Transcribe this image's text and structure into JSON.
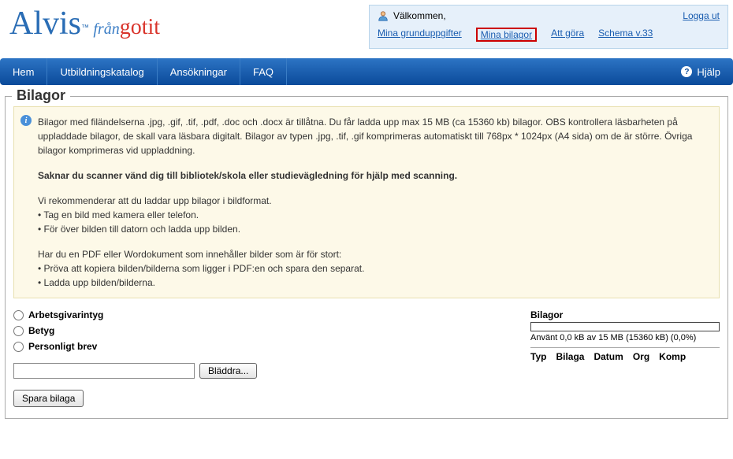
{
  "logo": {
    "main": "Alvis",
    "tm": "™",
    "fran": "från",
    "gotit": "gotit"
  },
  "welcome": {
    "greeting": "Välkommen,",
    "logout": "Logga ut",
    "links": [
      {
        "label": "Mina grunduppgifter",
        "active": false
      },
      {
        "label": "Mina bilagor",
        "active": true
      },
      {
        "label": "Att göra",
        "active": false
      },
      {
        "label": "Schema v.33",
        "active": false
      }
    ]
  },
  "nav": {
    "items": [
      "Hem",
      "Utbildningskatalog",
      "Ansökningar",
      "FAQ"
    ],
    "help": "Hjälp"
  },
  "main": {
    "legend": "Bilagor",
    "info": {
      "p1": "Bilagor med filändelserna .jpg, .gif, .tif, .pdf, .doc och .docx är tillåtna. Du får ladda upp max 15 MB (ca 15360 kb) bilagor. OBS kontrollera läsbarheten på uppladdade bilagor, de skall vara läsbara digitalt. Bilagor av typen .jpg, .tif, .gif komprimeras automatiskt till 768px * 1024px (A4 sida) om de är större. Övriga bilagor komprimeras vid uppladdning.",
      "p2": "Saknar du scanner vänd dig till bibliotek/skola eller studievägledning för hjälp med scanning.",
      "p3a": "Vi rekommenderar att du laddar upp bilagor i bildformat.",
      "p3b": "• Tag en bild med kamera eller telefon.",
      "p3c": "• För över bilden till datorn och ladda upp bilden.",
      "p4a": "Har du en PDF eller Wordokument som innehåller bilder som är för stort:",
      "p4b": "• Pröva att kopiera bilden/bilderna som ligger i PDF:en och spara den separat.",
      "p4c": "• Ladda upp bilden/bilderna."
    },
    "radios": [
      "Arbetsgivarintyg",
      "Betyg",
      "Personligt brev"
    ],
    "browse": "Bläddra...",
    "save": "Spara bilaga",
    "attachments": {
      "title": "Bilagor",
      "usage": "Använt 0,0 kB av 15 MB (15360 kB) (0,0%)",
      "headers": [
        "Typ",
        "Bilaga",
        "Datum",
        "Org",
        "Komp"
      ]
    }
  }
}
